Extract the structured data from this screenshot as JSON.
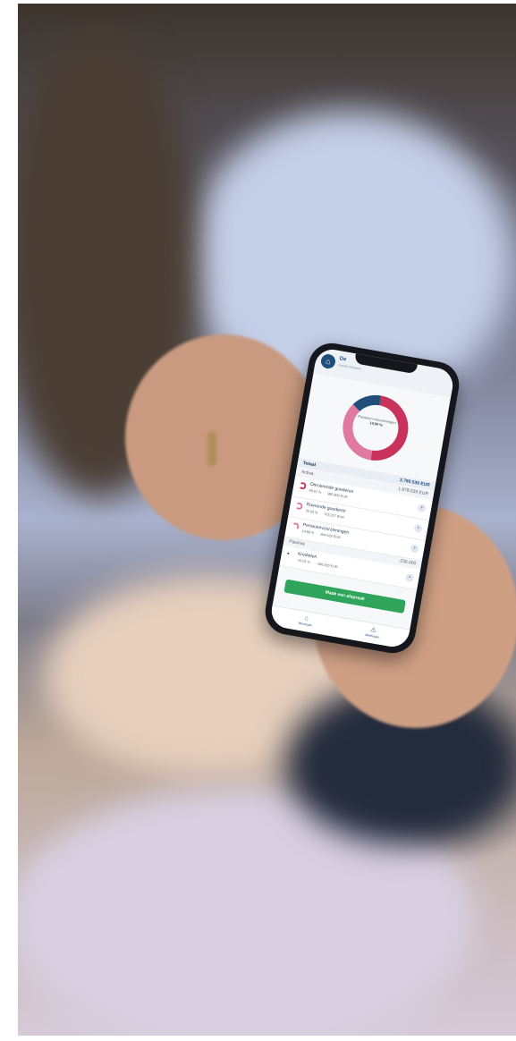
{
  "app": {
    "header_title": "De",
    "header_subtitle": "Familie Dolmans"
  },
  "donut": {
    "label": "Pensioen-voorzieningen",
    "value": "14,00 %",
    "segments": [
      {
        "name": "Onroerende goederen",
        "percent": 49.57,
        "color": "#c8325c"
      },
      {
        "name": "Roerende goederen",
        "percent": 35.54,
        "color": "#e07aa0"
      },
      {
        "name": "Pensioenvoorzieningen",
        "percent": 14.89,
        "color": "#1f4e7a"
      }
    ]
  },
  "totals": {
    "total_label": "Totaal",
    "total_amount": "3.780.539 EUR",
    "assets_label": "Activa",
    "assets_amount": "1.978.539 EUR",
    "liabilities_label": "Passiva",
    "liabilities_amount": "-236.000"
  },
  "items": [
    {
      "name": "Onroerende goederen",
      "percent": "49,57 %",
      "amount": "980.800 EUR",
      "color": "#c8325c"
    },
    {
      "name": "Roerende goederen",
      "percent": "35,54 %",
      "amount": "703.227 EUR",
      "color": "#e07aa0"
    },
    {
      "name": "Pensioenvoorzieningen",
      "percent": "14,89 %",
      "amount": "294.632 EUR",
      "color": "#e07aa0"
    }
  ],
  "liabilities_items": [
    {
      "name": "Kredieten",
      "percent": "-10,01 %",
      "amount": "-198.000 EUR"
    }
  ],
  "cta_label": "Maak een afspraak",
  "tabs": [
    {
      "label": "Woningen",
      "icon": "home-icon"
    },
    {
      "label": "Meldingen",
      "icon": "alert-icon"
    }
  ],
  "colors": {
    "brand": "#1f4e7a",
    "accent": "#c8325c",
    "cta": "#2fa55c"
  }
}
